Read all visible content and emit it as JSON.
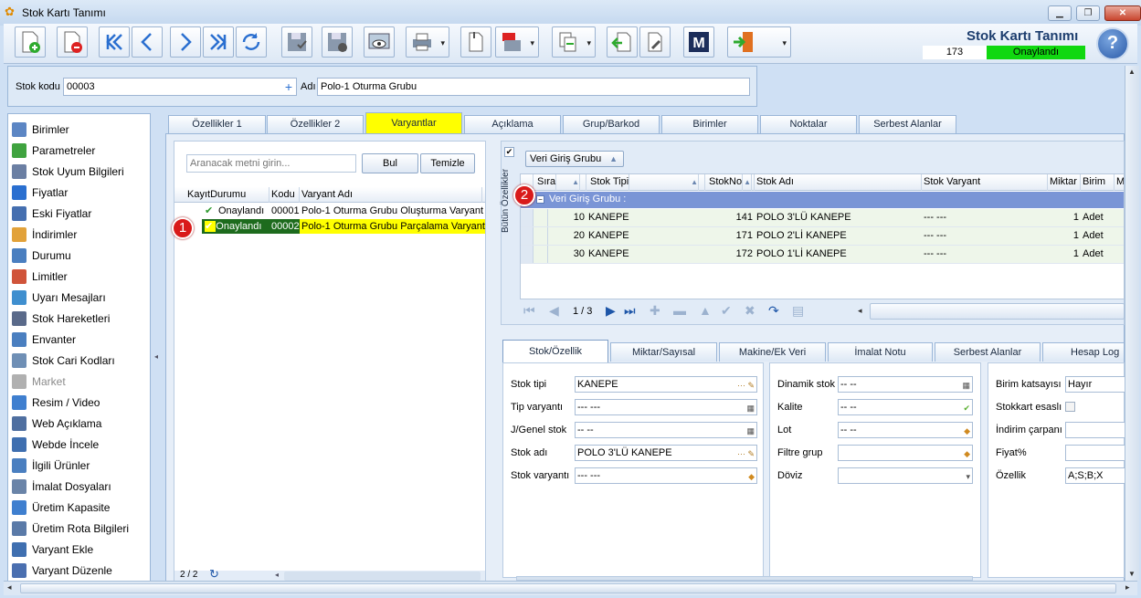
{
  "window": {
    "title": "Stok Kartı Tanımı"
  },
  "header": {
    "title": "Stok Kartı Tanımı",
    "record_no": "173",
    "status": "Onaylandı"
  },
  "form": {
    "stok_kodu_label": "Stok kodu",
    "stok_kodu": "00003",
    "adi_label": "Adı",
    "adi": "Polo-1 Oturma Grubu"
  },
  "sidebar": {
    "items": [
      {
        "label": "Birimler"
      },
      {
        "label": "Parametreler"
      },
      {
        "label": "Stok Uyum Bilgileri"
      },
      {
        "label": "Fiyatlar"
      },
      {
        "label": "Eski Fiyatlar"
      },
      {
        "label": "İndirimler"
      },
      {
        "label": "Durumu"
      },
      {
        "label": "Limitler"
      },
      {
        "label": "Uyarı Mesajları"
      },
      {
        "label": "Stok Hareketleri"
      },
      {
        "label": "Envanter"
      },
      {
        "label": "Stok Cari Kodları"
      },
      {
        "label": "Market"
      },
      {
        "label": "Resim / Video"
      },
      {
        "label": "Web Açıklama"
      },
      {
        "label": "Webde İncele"
      },
      {
        "label": "İlgili Ürünler"
      },
      {
        "label": "İmalat Dosyaları"
      },
      {
        "label": "Üretim Kapasite"
      },
      {
        "label": "Üretim Rota Bilgileri"
      },
      {
        "label": "Varyant Ekle"
      },
      {
        "label": "Varyant Düzenle"
      }
    ]
  },
  "tabs": [
    "Özellikler 1",
    "Özellikler 2",
    "Varyantlar",
    "Açıklama",
    "Grup/Barkod",
    "Birimler",
    "Noktalar",
    "Serbest Alanlar"
  ],
  "variants": {
    "search_placeholder": "Aranacak metni girin...",
    "find_label": "Bul",
    "clear_label": "Temizle",
    "columns": [
      "KayıtDurumu",
      "Kodu",
      "Varyant Adı"
    ],
    "rows": [
      {
        "durum": "Onaylandı",
        "kodu": "00001",
        "adi": "Polo-1 Oturma Grubu Oluşturma Varyantı"
      },
      {
        "durum": "Onaylandı",
        "kodu": "00002",
        "adi": "Polo-1 Oturma Grubu Parçalama Varyantı"
      }
    ],
    "pager": "2 / 2"
  },
  "badges": {
    "one": "1",
    "two": "2"
  },
  "detail": {
    "vertical_label": "Bütün Özellikler",
    "group_button": "Veri Giriş Grubu",
    "columns": [
      "Sıra",
      "Stok Tipi",
      "StokNo",
      "Stok Adı",
      "Stok Varyant",
      "Miktar",
      "Birim",
      "M"
    ],
    "group_row": "Veri Giriş Grubu :",
    "rows": [
      {
        "sira": "10",
        "tipi": "KANEPE",
        "stokno": "141",
        "adi": "POLO 3'LÜ KANEPE",
        "varyant": "--- ---",
        "miktar": "1",
        "birim": "Adet"
      },
      {
        "sira": "20",
        "tipi": "KANEPE",
        "stokno": "171",
        "adi": "POLO 2'Lİ KANEPE",
        "varyant": "--- ---",
        "miktar": "1",
        "birim": "Adet"
      },
      {
        "sira": "30",
        "tipi": "KANEPE",
        "stokno": "172",
        "adi": "POLO 1'Lİ KANEPE",
        "varyant": "--- ---",
        "miktar": "1",
        "birim": "Adet"
      }
    ],
    "nav_page": "1 / 3"
  },
  "bottom_tabs": [
    "Stok/Özellik",
    "Miktar/Sayısal",
    "Makine/Ek Veri",
    "İmalat Notu",
    "Serbest Alanlar",
    "Hesap Log"
  ],
  "fields_col1": [
    {
      "label": "Stok tipi",
      "value": "KANEPE"
    },
    {
      "label": "Tip varyantı",
      "value": "--- ---"
    },
    {
      "label": "J/Genel stok",
      "value": "-- --"
    },
    {
      "label": "Stok adı",
      "value": "POLO 3'LÜ KANEPE"
    },
    {
      "label": "Stok varyantı",
      "value": "--- ---"
    }
  ],
  "fields_col2": [
    {
      "label": "Dinamik stok",
      "value": "-- --"
    },
    {
      "label": "Kalite",
      "value": "-- --"
    },
    {
      "label": "Lot",
      "value": "-- --"
    },
    {
      "label": "Filtre grup",
      "value": ""
    },
    {
      "label": "Döviz",
      "value": ""
    }
  ],
  "fields_col3": [
    {
      "label": "Birim katsayısı",
      "value": "Hayır"
    },
    {
      "label": "Stokkart esaslı",
      "value": ""
    },
    {
      "label": "İndirim çarpanı",
      "value": ""
    },
    {
      "label": "Fiyat%",
      "value": ""
    },
    {
      "label": "Özellik",
      "value": "A;S;B;X"
    }
  ],
  "colors": {
    "accent_yellow": "#ffff00",
    "status_green": "#10d810",
    "group_row": "#7a95d6",
    "badge_red": "#d91a1a"
  }
}
